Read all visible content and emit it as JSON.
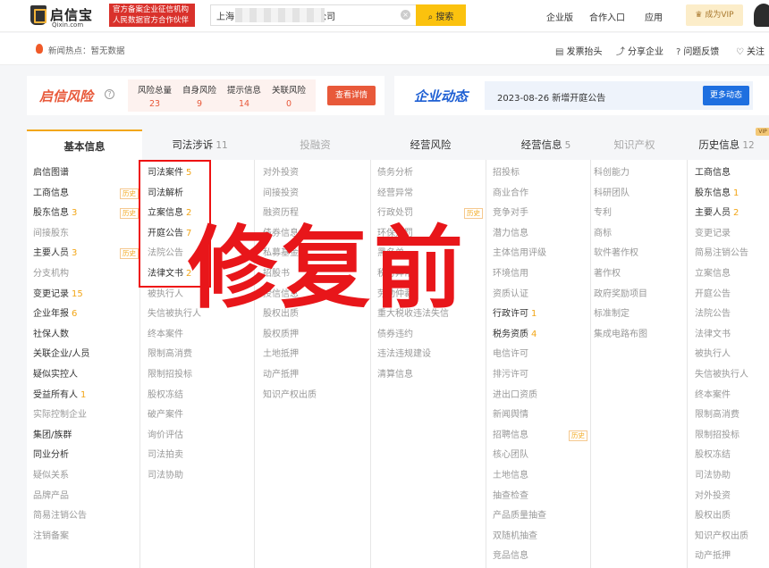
{
  "header": {
    "logo_name": "启信宝",
    "logo_domain": "Qixin.com",
    "badge_line1": "官方备案企业征信机构",
    "badge_line2": "人民数据官方合作伙伴",
    "search_value": "上海                       有限公司",
    "search_button": "搜索",
    "nav": [
      "企业版",
      "合作入口",
      "应用"
    ],
    "vip_button": "成为VIP"
  },
  "subbar": {
    "hot_news": "新闻热点：暂无数据",
    "actions": [
      "发票抬头",
      "分享企业",
      "问题反馈",
      "关注"
    ]
  },
  "risk": {
    "title": "启信风险",
    "stats": [
      {
        "label": "风险总量",
        "value": "23"
      },
      {
        "label": "自身风险",
        "value": "9"
      },
      {
        "label": "提示信息",
        "value": "14"
      },
      {
        "label": "关联风险",
        "value": "0"
      }
    ],
    "button": "查看详情"
  },
  "dynamics": {
    "title": "企业动态",
    "text": "2023-08-26 新增开庭公告",
    "button": "更多动态"
  },
  "tabs": [
    {
      "label": "基本信息",
      "count": ""
    },
    {
      "label": "司法涉诉",
      "count": "11"
    },
    {
      "label": "投融资",
      "count": ""
    },
    {
      "label": "经营风险",
      "count": ""
    },
    {
      "label": "经营信息",
      "count": "5"
    },
    {
      "label": "知识产权",
      "count": ""
    },
    {
      "label": "历史信息",
      "count": "12"
    }
  ],
  "vip_tag": "VIP",
  "watermark": "修复前",
  "columns": {
    "c1": [
      {
        "t": "启信图谱"
      },
      {
        "t": "工商信息",
        "h": "历史"
      },
      {
        "t": "股东信息",
        "n": "3",
        "h": "历史"
      },
      {
        "t": "间接股东",
        "dim": true
      },
      {
        "t": "主要人员",
        "n": "3",
        "h": "历史"
      },
      {
        "t": "分支机构",
        "dim": true
      },
      {
        "t": "变更记录",
        "n": "15"
      },
      {
        "t": "企业年报",
        "n": "6"
      },
      {
        "t": "社保人数"
      },
      {
        "t": "关联企业/人员"
      },
      {
        "t": "疑似实控人"
      },
      {
        "t": "受益所有人",
        "n": "1"
      },
      {
        "t": "实际控制企业",
        "dim": true
      },
      {
        "t": "集团/族群"
      },
      {
        "t": "同业分析"
      },
      {
        "t": "疑似关系",
        "dim": true
      },
      {
        "t": "品牌产品",
        "dim": true
      },
      {
        "t": "简易注销公告",
        "dim": true
      },
      {
        "t": "注销备案",
        "dim": true
      }
    ],
    "c2": [
      {
        "t": "司法案件",
        "n": "5"
      },
      {
        "t": "司法解析"
      },
      {
        "t": "立案信息",
        "n": "2"
      },
      {
        "t": "开庭公告",
        "n": "7"
      },
      {
        "t": "法院公告",
        "dim": true
      },
      {
        "t": "法律文书",
        "n": "2"
      },
      {
        "t": "被执行人",
        "dim": true
      },
      {
        "t": "失信被执行人",
        "dim": true
      },
      {
        "t": "终本案件",
        "dim": true
      },
      {
        "t": "限制高消费",
        "dim": true
      },
      {
        "t": "限制招投标",
        "dim": true
      },
      {
        "t": "股权冻结",
        "dim": true
      },
      {
        "t": "破产案件",
        "dim": true
      },
      {
        "t": "询价评估",
        "dim": true
      },
      {
        "t": "司法拍卖",
        "dim": true
      },
      {
        "t": "司法协助",
        "dim": true
      }
    ],
    "c3": [
      {
        "t": "对外投资",
        "dim": true
      },
      {
        "t": "间接投资",
        "dim": true
      },
      {
        "t": "融资历程",
        "dim": true
      },
      {
        "t": "债券信息",
        "dim": true
      },
      {
        "t": "私募基金",
        "dim": true
      },
      {
        "t": "招股书",
        "dim": true
      },
      {
        "t": "授信信息",
        "dim": true
      },
      {
        "t": "股权出质",
        "dim": true
      },
      {
        "t": "股权质押",
        "dim": true
      },
      {
        "t": "土地抵押",
        "dim": true
      },
      {
        "t": "动产抵押",
        "dim": true
      },
      {
        "t": "知识产权出质",
        "dim": true
      }
    ],
    "c4": [
      {
        "t": "债务分析",
        "dim": true
      },
      {
        "t": "经营异常",
        "dim": true
      },
      {
        "t": "行政处罚",
        "dim": true,
        "h": "历史"
      },
      {
        "t": "环保处罚",
        "dim": true
      },
      {
        "t": "黑名单",
        "dim": true
      },
      {
        "t": "税务异常",
        "dim": true
      },
      {
        "t": "劳动仲裁",
        "dim": true
      },
      {
        "t": "重大税收违法失信",
        "dim": true
      },
      {
        "t": "债券违约",
        "dim": true
      },
      {
        "t": "违法违规建设",
        "dim": true
      },
      {
        "t": "清算信息",
        "dim": true
      }
    ],
    "c5": [
      {
        "t": "招投标",
        "dim": true
      },
      {
        "t": "商业合作",
        "dim": true
      },
      {
        "t": "竞争对手",
        "dim": true
      },
      {
        "t": "潜力信息",
        "dim": true
      },
      {
        "t": "主体信用评级",
        "dim": true
      },
      {
        "t": "环境信用",
        "dim": true
      },
      {
        "t": "资质认证",
        "dim": true
      },
      {
        "t": "行政许可",
        "n": "1"
      },
      {
        "t": "税务资质",
        "n": "4"
      },
      {
        "t": "电信许可",
        "dim": true
      },
      {
        "t": "排污许可",
        "dim": true
      },
      {
        "t": "进出口资质",
        "dim": true
      },
      {
        "t": "新闻舆情",
        "dim": true
      },
      {
        "t": "招聘信息",
        "dim": true,
        "h": "历史"
      },
      {
        "t": "核心团队",
        "dim": true
      },
      {
        "t": "土地信息",
        "dim": true
      },
      {
        "t": "抽查检查",
        "dim": true
      },
      {
        "t": "产品质量抽查",
        "dim": true
      },
      {
        "t": "双随机抽查",
        "dim": true
      },
      {
        "t": "竞品信息",
        "dim": true
      }
    ],
    "c6": [
      {
        "t": "科创能力",
        "dim": true
      },
      {
        "t": "科研团队",
        "dim": true
      },
      {
        "t": "专利",
        "dim": true
      },
      {
        "t": "商标",
        "dim": true
      },
      {
        "t": "软件著作权",
        "dim": true
      },
      {
        "t": "著作权",
        "dim": true
      },
      {
        "t": "政府奖励项目",
        "dim": true
      },
      {
        "t": "标准制定",
        "dim": true
      },
      {
        "t": "集成电路布图",
        "dim": true
      }
    ],
    "c7": [
      {
        "t": "工商信息"
      },
      {
        "t": "股东信息",
        "n": "1"
      },
      {
        "t": "主要人员",
        "n": "2"
      },
      {
        "t": "变更记录",
        "dim": true
      },
      {
        "t": "简易注销公告",
        "dim": true
      },
      {
        "t": "立案信息",
        "dim": true
      },
      {
        "t": "开庭公告",
        "dim": true
      },
      {
        "t": "法院公告",
        "dim": true
      },
      {
        "t": "法律文书",
        "dim": true
      },
      {
        "t": "被执行人",
        "dim": true
      },
      {
        "t": "失信被执行人",
        "dim": true
      },
      {
        "t": "终本案件",
        "dim": true
      },
      {
        "t": "限制高消费",
        "dim": true
      },
      {
        "t": "限制招投标",
        "dim": true
      },
      {
        "t": "股权冻结",
        "dim": true
      },
      {
        "t": "司法协助",
        "dim": true
      },
      {
        "t": "对外投资",
        "dim": true
      },
      {
        "t": "股权出质",
        "dim": true
      },
      {
        "t": "知识产权出质",
        "dim": true
      },
      {
        "t": "动产抵押",
        "dim": true
      }
    ]
  }
}
